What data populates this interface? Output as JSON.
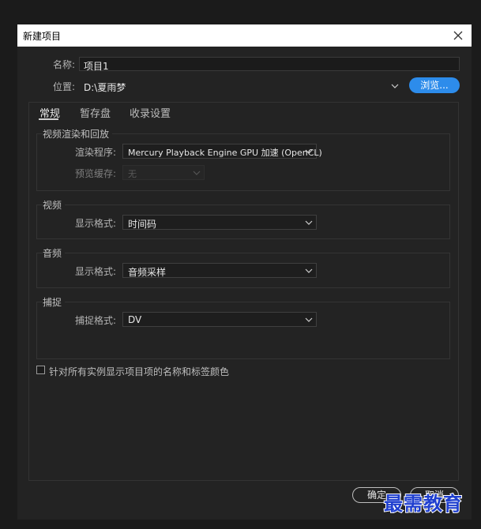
{
  "dialog": {
    "title": "新建项目",
    "close_icon": "close-icon"
  },
  "project": {
    "name_label": "名称:",
    "name_value": "项目1",
    "location_label": "位置:",
    "location_value": "D:\\夏雨梦",
    "browse_label": "浏览..."
  },
  "tabs": [
    {
      "label": "常规",
      "active": true
    },
    {
      "label": "暂存盘",
      "active": false
    },
    {
      "label": "收录设置",
      "active": false
    }
  ],
  "video_rendering": {
    "title": "视频渲染和回放",
    "renderer_label": "渲染程序:",
    "renderer_value": "Mercury Playback Engine GPU 加速 (OpenCL)",
    "preview_cache_label": "预览缓存:",
    "preview_cache_value": "无"
  },
  "video": {
    "title": "视频",
    "display_format_label": "显示格式:",
    "display_format_value": "时间码"
  },
  "audio": {
    "title": "音频",
    "display_format_label": "显示格式:",
    "display_format_value": "音频采样"
  },
  "capture": {
    "title": "捕捉",
    "capture_format_label": "捕捉格式:",
    "capture_format_value": "DV"
  },
  "options": {
    "show_colors_label": "针对所有实例显示项目项的名称和标签颜色",
    "show_colors_checked": false
  },
  "footer": {
    "ok_label": "确定",
    "cancel_label": "取消"
  },
  "watermark": "最需教育",
  "colors": {
    "accent": "#2d8ceb",
    "background": "#232323",
    "titlebar": "#ffffff"
  }
}
